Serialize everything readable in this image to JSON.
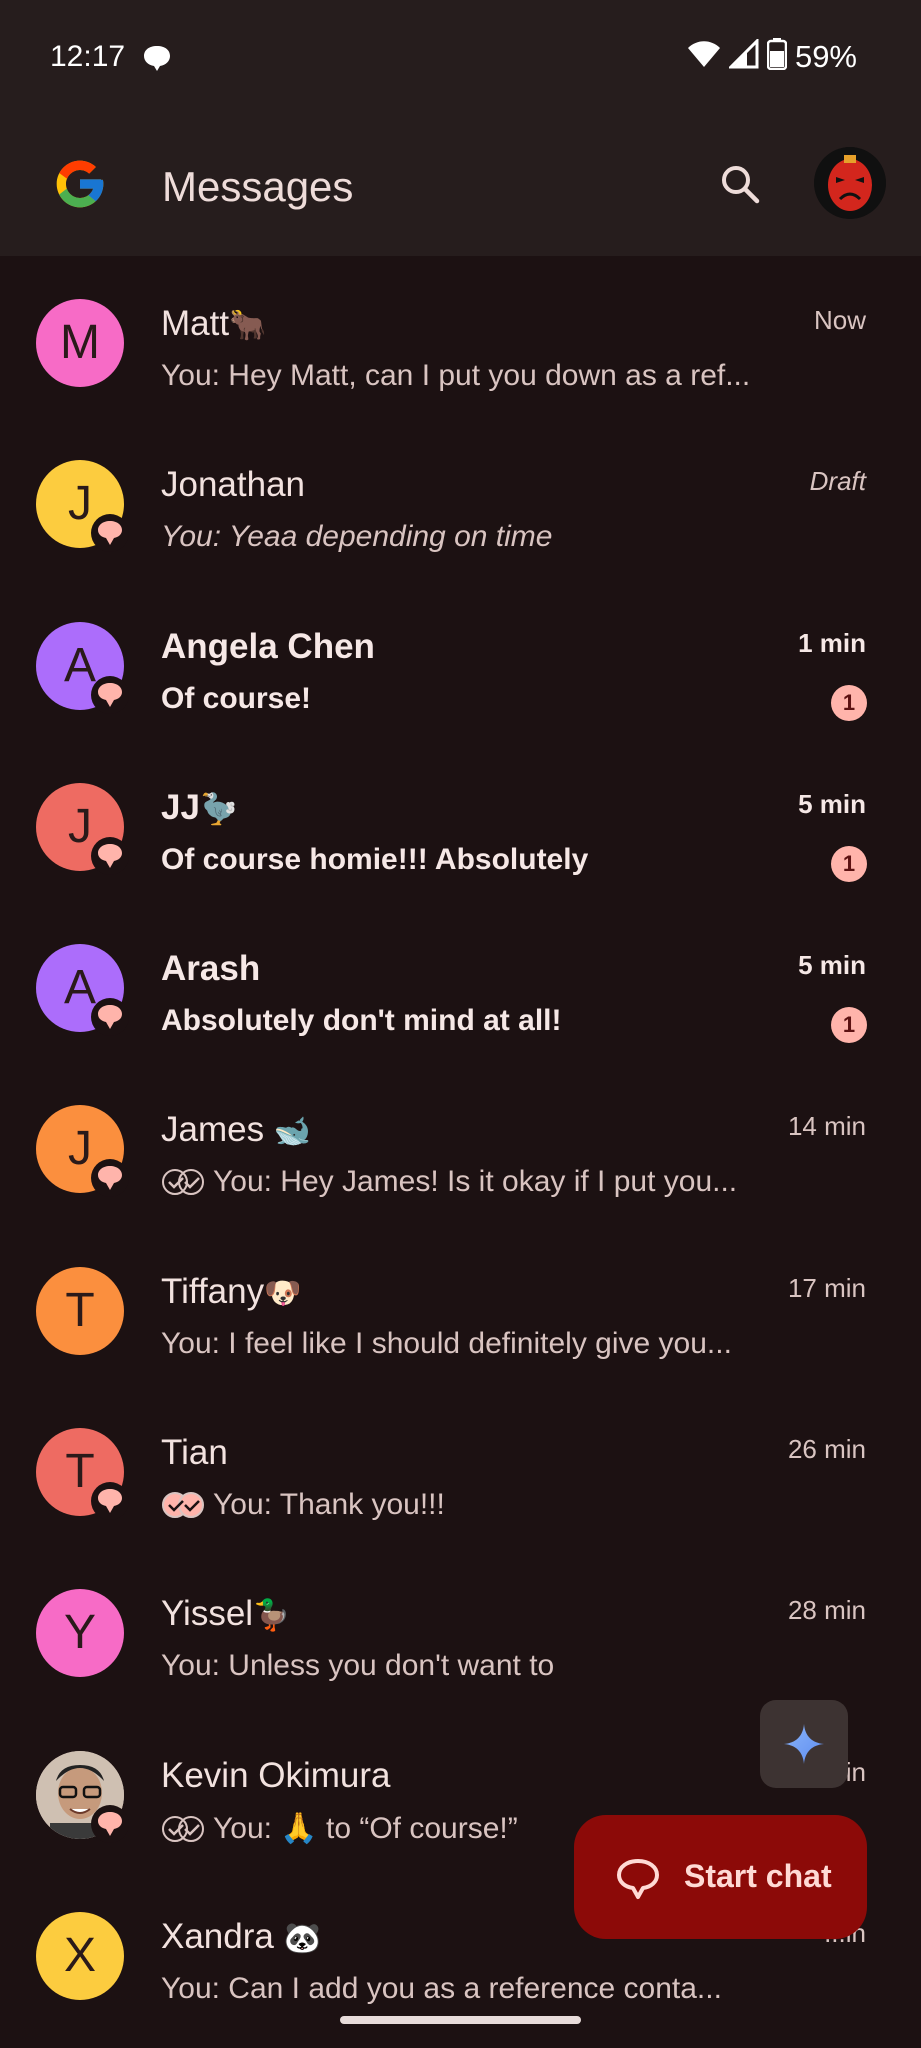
{
  "status_bar": {
    "time": "12:17",
    "battery": "59%",
    "icons": [
      "chat-bubble-icon",
      "wifi-icon",
      "signal-icon",
      "battery-icon"
    ]
  },
  "app_bar": {
    "logo": "google-g-logo",
    "title": "Messages",
    "search_icon": "search-icon",
    "account_icon": "account-avatar"
  },
  "conversations": [
    {
      "initial": "M",
      "avatar_color": "#f76bc6",
      "name": "Matt",
      "emoji": "🐂",
      "time": "Now",
      "preview": "You: Hey Matt, can I put you down as a ref...",
      "unread": false,
      "rcs": false
    },
    {
      "initial": "J",
      "avatar_color": "#fccc3f",
      "name": "Jonathan",
      "emoji": "",
      "time": "Draft",
      "preview": "You: Yeaa depending on time",
      "unread": false,
      "rcs": true,
      "draft": true
    },
    {
      "initial": "A",
      "avatar_color": "#ac6dfb",
      "name": "Angela Chen",
      "emoji": "",
      "time": "1 min",
      "preview": "Of course!",
      "unread": true,
      "unread_count": "1",
      "rcs": true
    },
    {
      "initial": "J",
      "avatar_color": "#ee6b62",
      "name": "JJ",
      "emoji": "🦤",
      "time": "5 min",
      "preview": "Of course homie!!! Absolutely",
      "unread": true,
      "unread_count": "1",
      "rcs": true
    },
    {
      "initial": "A",
      "avatar_color": "#ac6dfb",
      "name": "Arash",
      "emoji": "",
      "time": "5 min",
      "preview": "Absolutely don't mind at all!",
      "unread": true,
      "unread_count": "1",
      "rcs": true
    },
    {
      "initial": "J",
      "avatar_color": "#fb8f3e",
      "name": "James ",
      "emoji": "🐋",
      "time": "14 min",
      "preview": "You: Hey James! Is it okay if I put you...",
      "unread": false,
      "rcs": true,
      "ticks": "read"
    },
    {
      "initial": "T",
      "avatar_color": "#fb8f3e",
      "name": "Tiffany",
      "emoji": "🐶",
      "time": "17 min",
      "preview": "You: I feel like I should definitely give you...",
      "unread": false,
      "rcs": false
    },
    {
      "initial": "T",
      "avatar_color": "#ee6b62",
      "name": "Tian",
      "emoji": "",
      "time": "26 min",
      "preview": "You: Thank you!!!",
      "unread": false,
      "rcs": true,
      "ticks": "delivered"
    },
    {
      "initial": "Y",
      "avatar_color": "#f76bc6",
      "name": "Yissel",
      "emoji": "🦆",
      "time": "28 min",
      "preview": "You: Unless you don't want to",
      "unread": false,
      "rcs": false
    },
    {
      "initial": "",
      "avatar_color": "#d8c9bd",
      "name": "Kevin Okimura",
      "emoji": "",
      "time": "...in",
      "preview": "You:  🙏  to “Of course!”",
      "unread": false,
      "rcs": true,
      "photo": true,
      "ticks": "read"
    },
    {
      "initial": "X",
      "avatar_color": "#fccc3f",
      "name": "Xandra ",
      "emoji": "🐼",
      "time": "...in",
      "preview": "You: Can I add you as a reference conta...",
      "unread": false,
      "rcs": false
    }
  ],
  "fab": {
    "gemini_icon": "sparkle-icon",
    "start_chat_label": "Start chat",
    "start_chat_icon": "chat-bubble-icon"
  }
}
